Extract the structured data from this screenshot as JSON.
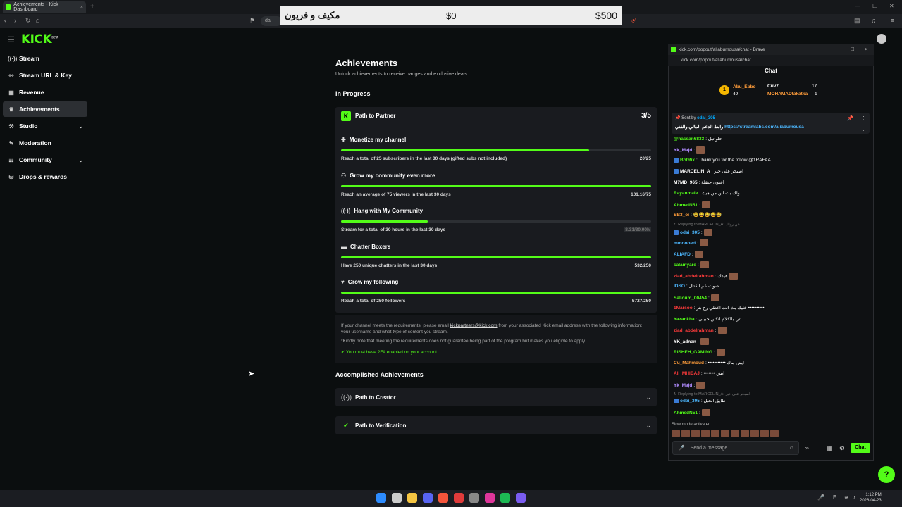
{
  "browser": {
    "tab_title": "Achievements - Kick Dashboard",
    "tab_close": "×",
    "new_tab": "+",
    "url_fragment": "da"
  },
  "overlay": {
    "arabic_text": "مكيف و فريون",
    "low": "$0",
    "high": "$500"
  },
  "sidebar": {
    "logo": "KICK",
    "logo_sup": "BETA",
    "items": [
      {
        "label": "Stream",
        "icon": "((·))"
      },
      {
        "label": "Stream URL & Key",
        "icon": "⚯"
      },
      {
        "label": "Revenue",
        "icon": "▦"
      },
      {
        "label": "Achievements",
        "icon": "♛"
      },
      {
        "label": "Studio",
        "icon": "⚒",
        "chevron": "⌄"
      },
      {
        "label": "Moderation",
        "icon": "✎"
      },
      {
        "label": "Community",
        "icon": "☷",
        "chevron": "⌄"
      },
      {
        "label": "Drops & rewards",
        "icon": "⛁"
      }
    ]
  },
  "main": {
    "title": "Achievements",
    "subtitle": "Unlock achievements to receive badges and exclusive deals",
    "in_progress_label": "In Progress",
    "partner": {
      "badge": "K",
      "title": "Path to Partner",
      "count": "3/5",
      "goals": [
        {
          "title": "Monetize my channel",
          "icon": "✚",
          "desc": "Reach a total of 25 subscribers in the last 30 days (gifted subs not included)",
          "value": "20/25",
          "progress": 0.8
        },
        {
          "title": "Grow my community even more",
          "icon": "⚇",
          "desc": "Reach an average of 75 viewers in the last 30 days",
          "value": "101.16/75",
          "progress": 1.0
        },
        {
          "title": "Hang with My Community",
          "icon": "((·))",
          "desc": "Stream for a total of 30 hours in the last 30 days",
          "value": "8.31/30.00h",
          "progress": 0.28
        },
        {
          "title": "Chatter Boxers",
          "icon": "▬",
          "desc": "Have 250 unique chatters in the last 30 days",
          "value": "532/250",
          "progress": 1.0
        },
        {
          "title": "Grow my following",
          "icon": "♥",
          "desc": "Reach a total of 250 followers",
          "value": "5727/250",
          "progress": 1.0
        }
      ]
    },
    "info": {
      "line1_a": "If your channel meets the requirements, please email ",
      "email": "kickpartners@kick.com",
      "line1_b": " from your associated Kick email address with the following information: your username and what type of content you stream.",
      "line2": "*Kindly note that meeting the requirements does not guarantee being part of the program but makes you eligible to apply.",
      "line3": "You must have 2FA enabled on your account"
    },
    "accomplished_label": "Accomplished Achievements",
    "accomplished": [
      {
        "title": "Path to Creator",
        "icon": "((·))"
      },
      {
        "title": "Path to Verification",
        "icon": "✔"
      }
    ]
  },
  "chat": {
    "window_url": "kick.com/popout/aliabumousa/chat - Brave",
    "address": "kick.com/popout/aliabumousa/chat",
    "header": "Chat",
    "gifters": [
      {
        "name": "Abu_Ebbo",
        "count": "40"
      },
      {
        "name": "Cuv7",
        "count": "17"
      },
      {
        "name": "MOHAMADtakatka",
        "count": "1"
      }
    ],
    "pinned_by_label": "Sent by",
    "pinned_by": "odai_305",
    "pinned_text": "رابط الدعم المالي والفني",
    "pinned_link": "https://streamlabs.com/aliabumousa",
    "messages": [
      {
        "user": "@hassan6833",
        "color": "#53fc18",
        "text": ": حلو تيل"
      },
      {
        "user": "Yk_Majd",
        "color": "#b18cff",
        "text": ":",
        "emote": true
      },
      {
        "user": "BotRix",
        "color": "#53fc18",
        "text": ": Thank you for the follow @1RAFAA",
        "badge": true
      },
      {
        "user": "MARCELIN_A",
        "color": "#ffffff",
        "text": ": اصبحر على خير",
        "badge": true
      },
      {
        "user": "M7MD_965",
        "color": "#ffffff",
        "text": ": اعيون حتقلة"
      },
      {
        "user": "Rayanmale",
        "color": "#53fc18",
        "text": ": ولك بث ابن من هيك"
      },
      {
        "user": "AhmedN51",
        "color": "#53fc18",
        "text": ":",
        "emote": true
      },
      {
        "user": "SB3_oi",
        "color": "#ff9d3b",
        "text": ": 😂😂😂😂😂"
      },
      {
        "user": "odai_305",
        "color": "#4db8ff",
        "text": ":",
        "badge": true,
        "emote": true
      },
      {
        "user": "mmoooed",
        "color": "#4db8ff",
        "text": ":",
        "emote": true
      },
      {
        "user": "ALIAFD",
        "color": "#4db8ff",
        "text": ":",
        "emote": true
      },
      {
        "user": "salamyare",
        "color": "#53fc18",
        "text": ":",
        "emote": true
      },
      {
        "user": "ziad_abdelrahman",
        "color": "#ff3b3b",
        "text": ": هيدك",
        "emote": true
      },
      {
        "user": "IDSO",
        "color": "#4db8ff",
        "text": ": صوت عم القتال"
      },
      {
        "user": "Salloum_00454",
        "color": "#53fc18",
        "text": ":",
        "emote": true
      },
      {
        "user": "1Marsoo",
        "color": "#ff3b3b",
        "text": ": خليك بث انت اعطي رح هز ••••••••••"
      },
      {
        "user": "Yazankha",
        "color": "#53fc18",
        "text": ": ترا بالكلام انكبن حبيبي"
      },
      {
        "user": "ziad_abdelrahman",
        "color": "#ff3b3b",
        "text": ":",
        "emote": true
      },
      {
        "user": "YK_adnan",
        "color": "#ffffff",
        "text": ":",
        "emote": true
      },
      {
        "user": "RISHEH_GAMING",
        "color": "#53fc18",
        "text": ":",
        "emote": true
      },
      {
        "user": "Cu_Mahmoud",
        "color": "#ff9d3b",
        "text": ": ••••••••••• ايش ماك"
      },
      {
        "user": "Ali_MHIBAJ",
        "color": "#ff3b3b",
        "text": ": ••••••• ايش"
      },
      {
        "user": "Yk_Majd",
        "color": "#b18cff",
        "text": ":",
        "emote": true
      },
      {
        "user": "odai_305",
        "color": "#4db8ff",
        "text": ": طايق الخيل",
        "badge": true
      },
      {
        "user": "AhmedN51",
        "color": "#53fc18",
        "text": ":",
        "emote": true
      }
    ],
    "reply1": "↻ Replying to MARCELIN_A: عن رولك",
    "reply2": "↻ Replying to MARCELIN_A: اصبحر على خير",
    "slow_mode": "Slow mode activated",
    "input_placeholder": "Send a message",
    "send_label": "Chat"
  },
  "taskbar": {
    "time": "1:12 PM",
    "date": "2026-04-23",
    "lang": "E"
  },
  "colors": {
    "accent": "#53fc18",
    "bg": "#0b0e0f",
    "card": "#191b1f"
  }
}
